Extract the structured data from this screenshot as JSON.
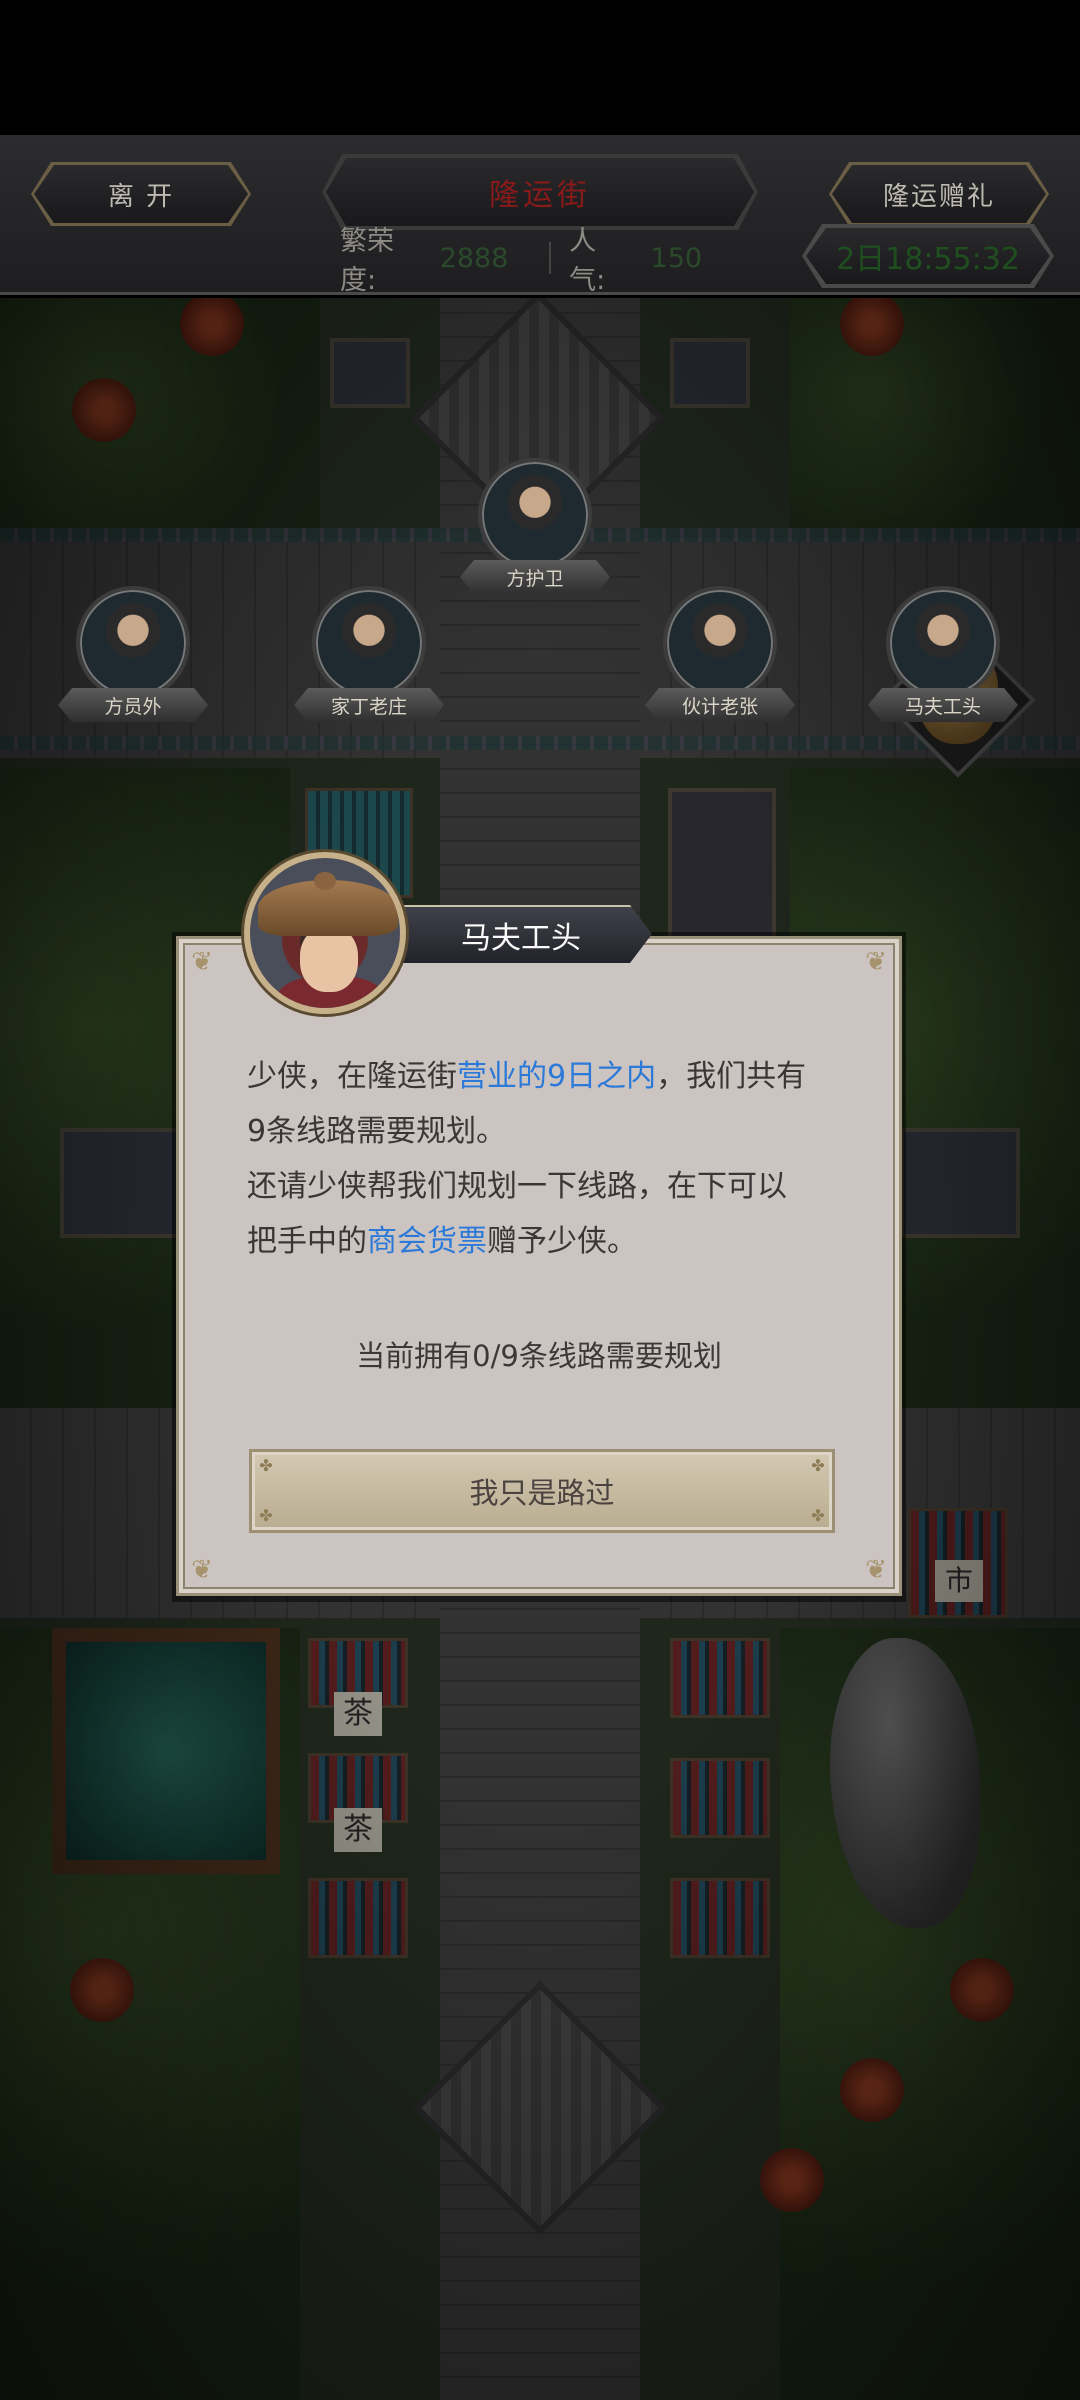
{
  "header": {
    "leave_label": "离 开",
    "street_title": "隆运街",
    "gift_label": "隆运赠礼",
    "prosperity_label": "繁荣度:",
    "prosperity_value": "2888",
    "popularity_label": "人 气:",
    "popularity_value": "150",
    "timer": "2日18:55:32"
  },
  "npcs": [
    {
      "name": "方护卫"
    },
    {
      "name": "方员外"
    },
    {
      "name": "家丁老庄"
    },
    {
      "name": "伙计老张"
    },
    {
      "name": "马夫工头"
    }
  ],
  "dialog": {
    "speaker": "马夫工头",
    "line1_a": "少侠，在隆运街",
    "line1_hl": "营业的9日之内",
    "line1_b": "，我们共有",
    "line2": "9条线路需要规划。",
    "line3": "还请少侠帮我们规划一下线路，在下可以",
    "line4_a": "把手中的",
    "line4_hl": "商会货票",
    "line4_b": "赠予少侠。",
    "progress": "当前拥有0/9条线路需要规划",
    "pass_button": "我只是路过"
  },
  "map_signs": {
    "tea1": "茶",
    "tea2": "茶",
    "market": "市"
  },
  "colors": {
    "highlight": "#2b79d8",
    "dialog_bg": "#ccc4c1",
    "button_bg": "#c8bca2"
  }
}
